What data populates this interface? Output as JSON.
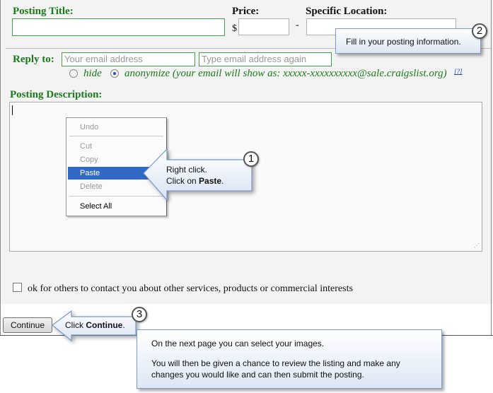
{
  "form": {
    "posting_title_label": "Posting Title:",
    "posting_title_value": "",
    "price_label": "Price:",
    "price_currency": "$",
    "price_value": "",
    "specific_location_label": "Specific Location:",
    "location_separator": "-",
    "location_value": "",
    "reply_to_label": "Reply to:",
    "email_placeholder": "Your email address",
    "email_again_placeholder": "Type email address again",
    "hide_label": "hide",
    "anonymize_label": "anonymize (your email will show as: xxxxx-xxxxxxxxxx@sale.craigslist.org)",
    "help_link": "[?]",
    "description_label": "Posting Description:",
    "description_value": "",
    "contact_checkbox_label": "ok for others to contact you about other services, products or commercial interests",
    "continue_button": "Continue"
  },
  "context_menu": {
    "items": [
      "Undo",
      "Cut",
      "Copy",
      "Paste",
      "Delete",
      "Select All"
    ],
    "selected": "Paste"
  },
  "callouts": {
    "step1": {
      "number": "1",
      "line1": "Right click.",
      "line2_prefix": "Click on ",
      "line2_bold": "Paste",
      "line2_suffix": "."
    },
    "step2": {
      "number": "2",
      "text": "Fill in your posting information."
    },
    "step3": {
      "number": "3",
      "prefix": "Click ",
      "bold": "Continue",
      "suffix": "."
    },
    "next_page": {
      "line1": "On the next page you can select your images.",
      "line2": "You will then be given a chance to review the listing and make any changes you would like and can then submit the posting."
    }
  },
  "colors": {
    "label_green": "#1b7a1b",
    "menu_highlight": "#316ac5",
    "callout_border": "#7a9ad0"
  }
}
